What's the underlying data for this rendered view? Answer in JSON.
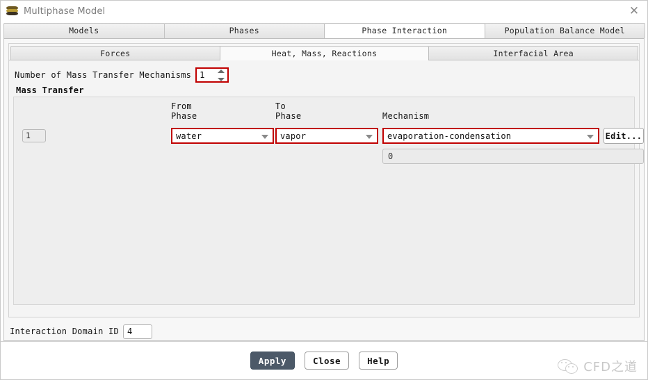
{
  "window": {
    "title": "Multiphase Model",
    "icon": "multiphase-layers-icon",
    "close_label": "✕"
  },
  "outer_tabs": [
    {
      "label": "Models",
      "active": false
    },
    {
      "label": "Phases",
      "active": false
    },
    {
      "label": "Phase Interaction",
      "active": true
    },
    {
      "label": "Population Balance Model",
      "active": false
    }
  ],
  "inner_tabs": [
    {
      "label": "Forces",
      "active": false
    },
    {
      "label": "Heat, Mass, Reactions",
      "active": true
    },
    {
      "label": "Interfacial Area",
      "active": false
    }
  ],
  "mechanisms": {
    "label": "Number of Mass Transfer Mechanisms",
    "value": "1",
    "up_icon": "chevron-up-icon",
    "down_icon": "chevron-down-icon"
  },
  "mass_transfer": {
    "group_title": "Mass Transfer",
    "columns": {
      "from_phase": "From\nPhase",
      "to_phase": "To\nPhase",
      "mechanism": "Mechanism"
    },
    "rows": [
      {
        "index": "1",
        "from_phase": "water",
        "to_phase": "vapor",
        "mechanism": "evaporation-condensation",
        "edit_label": "Edit...",
        "value": "0"
      }
    ],
    "dropdown_icon": "chevron-down-icon"
  },
  "interaction_domain": {
    "label": "Interaction Domain ID",
    "value": "4"
  },
  "footer": {
    "apply_label": "Apply",
    "close_label": "Close",
    "help_label": "Help"
  },
  "watermark": {
    "text": "CFD之道",
    "logo": "wechat-logo-icon"
  },
  "colors": {
    "highlight": "#c00000",
    "primary_button": "#4c5968",
    "panel_bg": "#f4f4f4",
    "group_bg": "#eeeeee"
  }
}
